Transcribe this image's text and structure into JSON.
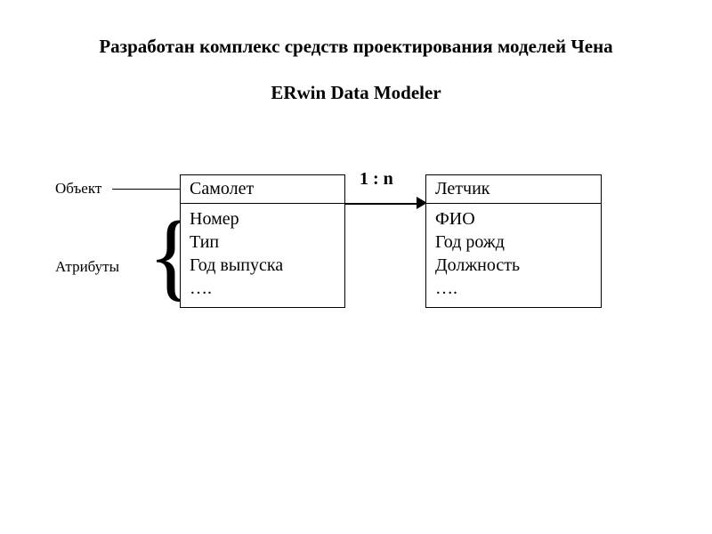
{
  "title": "Разработан комплекс средств проектирования моделей Чена",
  "subtitle": "ERwin  Data Modeler",
  "labels": {
    "object": "Объект",
    "attributes": "Атрибуты"
  },
  "relationship": {
    "cardinality": "1 : n"
  },
  "entities": {
    "left": {
      "name": "Самолет",
      "attrs": [
        "Номер",
        "Тип",
        "Год выпуска",
        "…."
      ]
    },
    "right": {
      "name": "Летчик",
      "attrs": [
        "ФИО",
        "Год рожд",
        "Должность",
        "…."
      ]
    }
  }
}
